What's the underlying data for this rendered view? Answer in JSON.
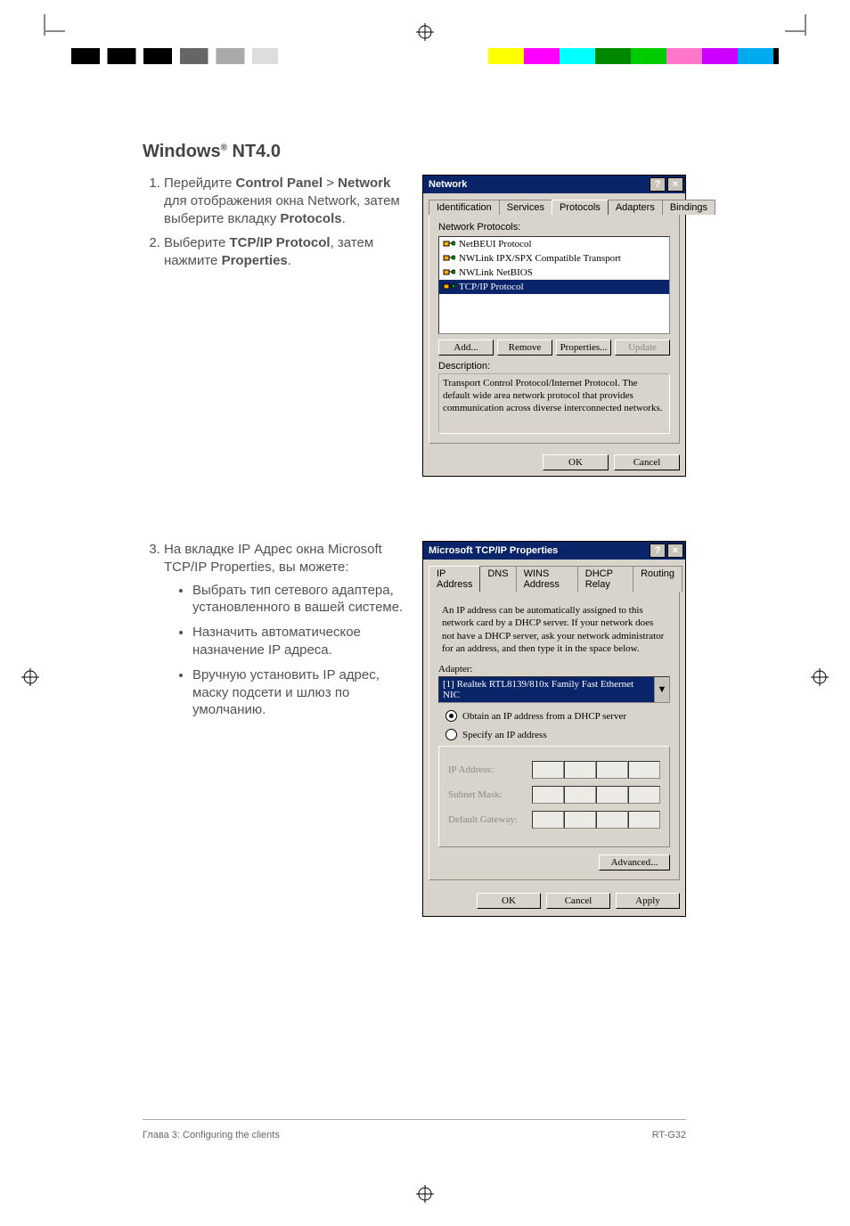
{
  "heading_prefix": "Windows",
  "heading_reg": "®",
  "heading_suffix": " NT4.0",
  "steps_a": {
    "s1_a": "Перейдите ",
    "s1_b1": "Control Panel",
    "s1_gt": " > ",
    "s1_b2": "Network",
    "s1_c": " для отображения окна Network, затем выберите вкладку ",
    "s1_b3": "Protocols",
    "s1_d": ".",
    "s2_a": "Выберите ",
    "s2_b1": "TCP/IP Protocol",
    "s2_c": ", затем нажмите ",
    "s2_b2": "Properties",
    "s2_d": "."
  },
  "dlg1": {
    "title": "Network",
    "tabs": [
      "Identification",
      "Services",
      "Protocols",
      "Adapters",
      "Bindings"
    ],
    "label_list": "Network Protocols:",
    "items": [
      "NetBEUI Protocol",
      "NWLink IPX/SPX Compatible Transport",
      "NWLink NetBIOS",
      "TCP/IP Protocol"
    ],
    "buttons": {
      "add": "Add...",
      "remove": "Remove",
      "props": "Properties...",
      "update": "Update"
    },
    "desc_label": "Description:",
    "desc_text": "Transport Control Protocol/Internet Protocol. The default wide area network protocol that provides communication across diverse interconnected networks.",
    "ok": "OK",
    "cancel": "Cancel"
  },
  "step3_a": "На вкладке IP Адрес окна Microsoft TCP/IP Properties, вы можете:",
  "step3_bullets": [
    "Выбрать тип сетевого адаптера, установленного в вашей системе.",
    "Назначить автоматическое назначение  IP адреса.",
    "Вручную установить IP адрес, маску подсети и шлюз по умолчанию."
  ],
  "dlg2": {
    "title": "Microsoft TCP/IP Properties",
    "tabs": [
      "IP Address",
      "DNS",
      "WINS Address",
      "DHCP Relay",
      "Routing"
    ],
    "intro": "An IP address can be automatically assigned to this network card by a DHCP server.  If your network does not have a DHCP server, ask your network administrator for an address, and then type it in the space below.",
    "adapter_label": "Adapter:",
    "adapter_value": "[1] Realtek RTL8139/810x Family Fast Ethernet NIC",
    "radio1": "Obtain an IP address from a DHCP server",
    "radio2": "Specify an IP address",
    "fld_ip": "IP Address:",
    "fld_mask": "Subnet Mask:",
    "fld_gw": "Default Gateway:",
    "advanced": "Advanced...",
    "ok": "OK",
    "cancel": "Cancel",
    "apply": "Apply"
  },
  "footer_left": "Глава 3: Configuring the clients",
  "footer_right": "RT-G32"
}
